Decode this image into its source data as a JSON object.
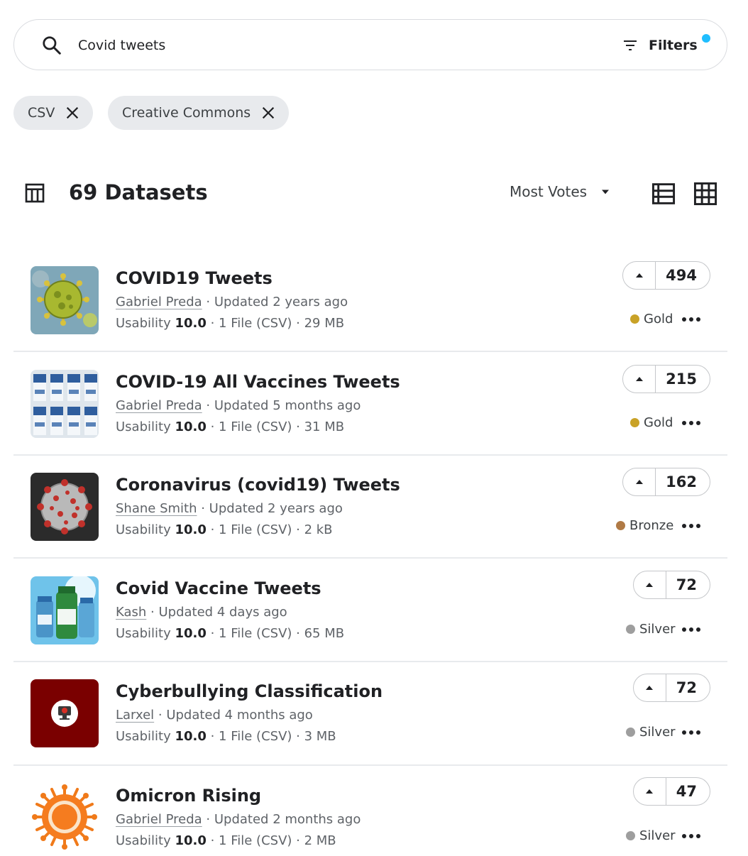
{
  "search": {
    "value": "Covid tweets",
    "filters_label": "Filters"
  },
  "chips": [
    {
      "label": "CSV"
    },
    {
      "label": "Creative Commons"
    }
  ],
  "results": {
    "count_label": "69 Datasets",
    "sort_label": "Most Votes"
  },
  "datasets": [
    {
      "title": "COVID19 Tweets",
      "author": "Gabriel Preda",
      "updated": " · Updated 2 years ago",
      "usability_label": "Usability ",
      "usability": "10.0",
      "files": " · 1 File (CSV) · 29 MB",
      "votes": "494",
      "medal": "Gold",
      "medal_color": "#c9a227",
      "thumb": "virus-yellow"
    },
    {
      "title": "COVID-19 All Vaccines Tweets",
      "author": "Gabriel Preda",
      "updated": " · Updated 5 months ago",
      "usability_label": "Usability ",
      "usability": "10.0",
      "files": " · 1 File (CSV) · 31 MB",
      "votes": "215",
      "medal": "Gold",
      "medal_color": "#c9a227",
      "thumb": "vaccine-vials"
    },
    {
      "title": "Coronavirus (covid19) Tweets",
      "author": "Shane Smith",
      "updated": " · Updated 2 years ago",
      "usability_label": "Usability ",
      "usability": "10.0",
      "files": " · 1 File (CSV) · 2 kB",
      "votes": "162",
      "medal": "Bronze",
      "medal_color": "#b07a45",
      "thumb": "virus-red"
    },
    {
      "title": "Covid Vaccine Tweets",
      "author": "Kash",
      "updated": " · Updated 4 days ago",
      "usability_label": "Usability ",
      "usability": "10.0",
      "files": " · 1 File (CSV) · 65 MB",
      "votes": "72",
      "medal": "Silver",
      "medal_color": "#9e9e9e",
      "thumb": "vaccine-blue"
    },
    {
      "title": "Cyberbullying Classification",
      "author": "Larxel",
      "updated": " · Updated 4 months ago",
      "usability_label": "Usability ",
      "usability": "10.0",
      "files": " · 1 File (CSV) · 3 MB",
      "votes": "72",
      "medal": "Silver",
      "medal_color": "#9e9e9e",
      "thumb": "cyber-badge"
    },
    {
      "title": "Omicron Rising",
      "author": "Gabriel Preda",
      "updated": " · Updated 2 months ago",
      "usability_label": "Usability ",
      "usability": "10.0",
      "files": " · 1 File (CSV) · 2 MB",
      "votes": "47",
      "medal": "Silver",
      "medal_color": "#9e9e9e",
      "thumb": "virus-orange"
    }
  ]
}
